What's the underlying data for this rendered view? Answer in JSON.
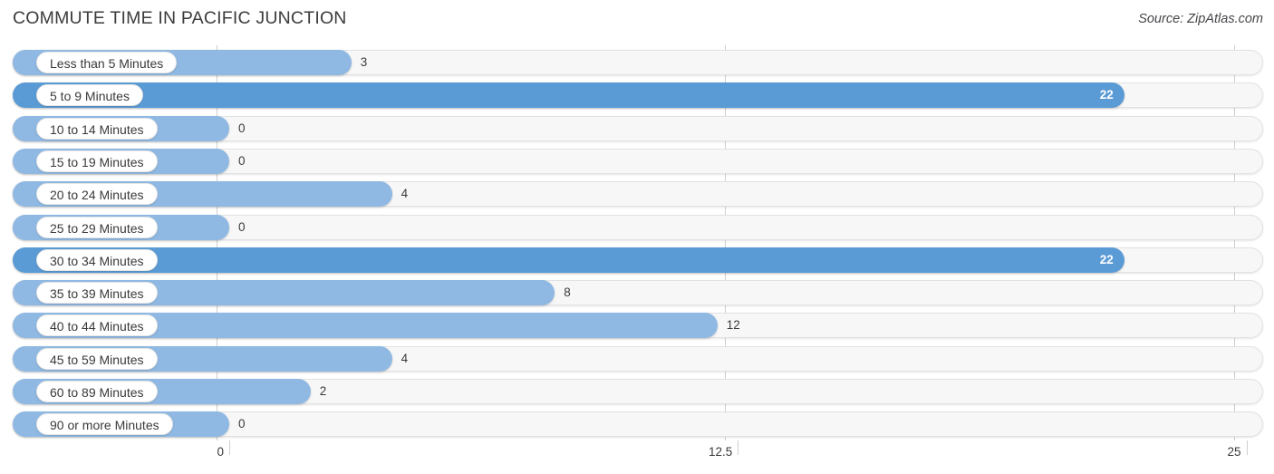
{
  "header": {
    "title": "COMMUTE TIME IN PACIFIC JUNCTION",
    "source": "Source: ZipAtlas.com"
  },
  "chart_data": {
    "type": "bar",
    "orientation": "horizontal",
    "title": "COMMUTE TIME IN PACIFIC JUNCTION",
    "xlabel": "",
    "ylabel": "",
    "xlim": [
      0,
      25
    ],
    "xticks": [
      0,
      12.5,
      25
    ],
    "xtick_labels": [
      "0",
      "12.5",
      "25"
    ],
    "grid": true,
    "legend": false,
    "categories": [
      "Less than 5 Minutes",
      "5 to 9 Minutes",
      "10 to 14 Minutes",
      "15 to 19 Minutes",
      "20 to 24 Minutes",
      "25 to 29 Minutes",
      "30 to 34 Minutes",
      "35 to 39 Minutes",
      "40 to 44 Minutes",
      "45 to 59 Minutes",
      "60 to 89 Minutes",
      "90 or more Minutes"
    ],
    "values": [
      3,
      22,
      0,
      0,
      4,
      0,
      22,
      8,
      12,
      4,
      2,
      0
    ],
    "value_labels": [
      "3",
      "22",
      "0",
      "0",
      "4",
      "0",
      "22",
      "8",
      "12",
      "4",
      "2",
      "0"
    ],
    "colors": {
      "bar_light": "#8fb9e3",
      "bar_highlight": "#5b9bd5",
      "track": "#f7f7f7",
      "gridline": "#cfcfcf"
    }
  }
}
